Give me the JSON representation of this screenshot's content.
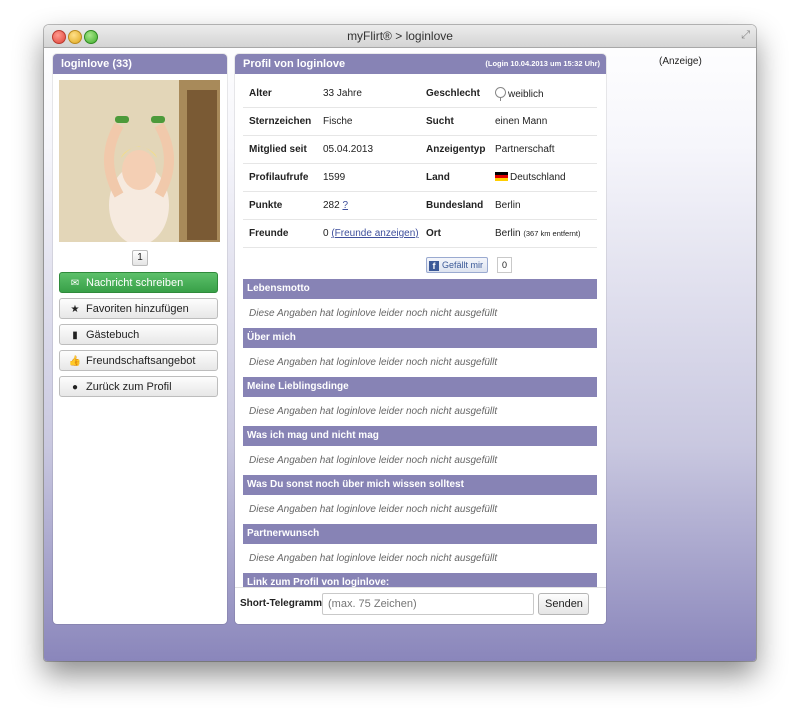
{
  "window": {
    "title": "myFlirt® > loginlove"
  },
  "profile_card": {
    "title": "loginlove (33)",
    "photo_page": "1",
    "buttons": {
      "message": "Nachricht schreiben",
      "favorite": "Favoriten hinzufügen",
      "guestbook": "Gästebuch",
      "friendship": "Freundschaftsangebot",
      "back": "Zurück zum Profil"
    }
  },
  "profile": {
    "title": "Profil von loginlove",
    "login_info": "(Login 10.04.2013 um 15:32 Uhr)",
    "rows": [
      {
        "k1": "Alter",
        "v1": "33 Jahre",
        "k2": "Geschlecht",
        "v2": "weiblich"
      },
      {
        "k1": "Sternzeichen",
        "v1": "Fische",
        "k2": "Sucht",
        "v2": "einen Mann"
      },
      {
        "k1": "Mitglied seit",
        "v1": "05.04.2013",
        "k2": "Anzeigentyp",
        "v2": "Partnerschaft"
      },
      {
        "k1": "Profilaufrufe",
        "v1": "1599",
        "k2": "Land",
        "v2": "Deutschland"
      },
      {
        "k1": "Punkte",
        "v1": "282",
        "v1_link": "?",
        "k2": "Bundesland",
        "v2": "Berlin"
      },
      {
        "k1": "Freunde",
        "v1": "0",
        "v1_link": "(Freunde anzeigen)",
        "k2": "Ort",
        "v2": "Berlin",
        "v2_small": "(367 km entfernt)"
      }
    ],
    "like_label": "Gefällt mir",
    "like_count": "0",
    "empty_text": "Diese Angaben hat loginlove leider noch nicht ausgefüllt",
    "sections": {
      "s1": "Lebensmotto",
      "s2": "Über mich",
      "s3": "Meine Lieblingsdinge",
      "s4": "Was ich mag und nicht mag",
      "s5": "Was Du sonst noch über mich wissen solltest",
      "s6": "Partnerwunsch",
      "s7": "Link zum Profil von loginlove:"
    },
    "compose": {
      "label": "Short-Telegramm",
      "placeholder": "(max. 75 Zeichen)",
      "send": "Senden"
    }
  },
  "ad": {
    "label": "(Anzeige)"
  },
  "icons": {
    "message": "envelope-icon",
    "favorite": "star-icon",
    "guestbook": "book-icon",
    "friendship": "thumbs-up-icon",
    "back": "user-icon"
  },
  "colors": {
    "header_purple": "#8783b5",
    "primary_green": "#45aa52",
    "facebook_blue": "#3b5998"
  }
}
